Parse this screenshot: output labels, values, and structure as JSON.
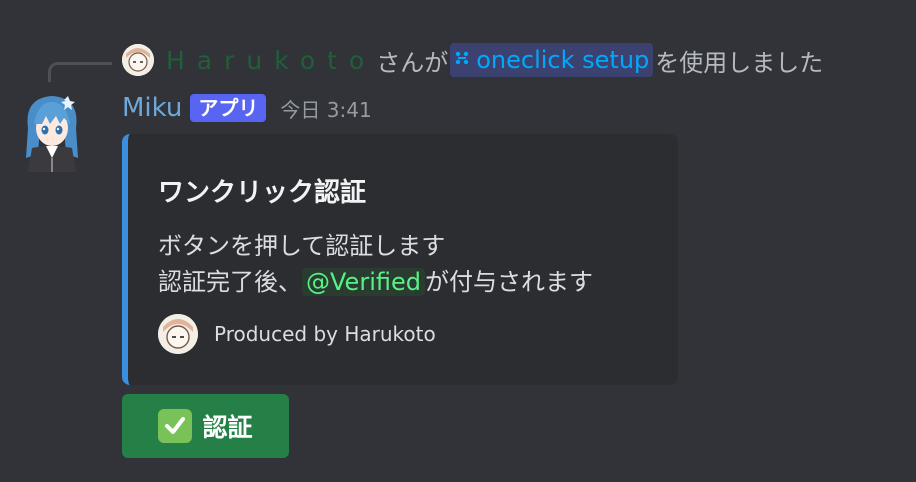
{
  "reply": {
    "user": "Harukoto",
    "text_after_user": "さんが",
    "command": "oneclick setup",
    "text_after_command": "を使用しました",
    "command_icon": "slash-command-icon"
  },
  "message": {
    "bot_name": "Miku",
    "app_tag": "アプリ",
    "timestamp": "今日 3:41"
  },
  "embed": {
    "accent_color": "#3b8fe0",
    "title": "ワンクリック認証",
    "desc_line1": "ボタンを押して認証します",
    "desc_line2_prefix": "認証完了後、",
    "role_mention": "@Verified",
    "desc_line2_suffix": "が付与されます",
    "footer_text": "Produced by Harukoto"
  },
  "button": {
    "label": "認証",
    "icon": "check-mark-icon",
    "color": "#248046"
  }
}
